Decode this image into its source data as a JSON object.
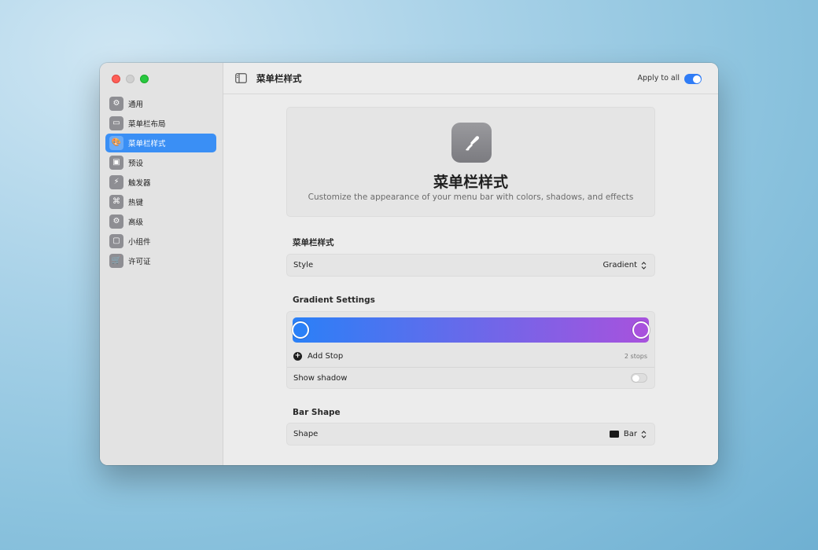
{
  "window": {
    "title": "菜单栏样式",
    "apply_to_all_label": "Apply to all",
    "apply_to_all_on": true
  },
  "sidebar": {
    "items": [
      {
        "label": "通用",
        "icon": "gear-icon",
        "glyph": "⚙",
        "active": false
      },
      {
        "label": "菜单栏布局",
        "icon": "menubar-layout-icon",
        "glyph": "▭",
        "active": false
      },
      {
        "label": "菜单栏样式",
        "icon": "palette-icon",
        "glyph": "🎨",
        "active": true
      },
      {
        "label": "预设",
        "icon": "preset-icon",
        "glyph": "▣",
        "active": false
      },
      {
        "label": "触发器",
        "icon": "bolt-icon",
        "glyph": "⚡",
        "active": false
      },
      {
        "label": "热键",
        "icon": "command-key-icon",
        "glyph": "⌘",
        "active": false
      },
      {
        "label": "高级",
        "icon": "gears-icon",
        "glyph": "⚙",
        "active": false
      },
      {
        "label": "小组件",
        "icon": "cube-icon",
        "glyph": "▢",
        "active": false
      },
      {
        "label": "许可证",
        "icon": "cart-icon",
        "glyph": "🛒",
        "active": false
      }
    ]
  },
  "hero": {
    "icon": "paintbrush-icon",
    "title": "菜单栏样式",
    "subtitle": "Customize the appearance of your menu bar with colors, shadows, and effects"
  },
  "style_section": {
    "title": "菜单栏样式",
    "row_label": "Style",
    "value": "Gradient"
  },
  "gradient_section": {
    "title": "Gradient Settings",
    "colors": {
      "start": "#2a80f7",
      "end": "#a852dd"
    },
    "add_stop_label": "Add Stop",
    "stops_count": "2 stops",
    "show_shadow_label": "Show shadow",
    "show_shadow_on": false
  },
  "shape_section": {
    "title": "Bar Shape",
    "row_label": "Shape",
    "value": "Bar"
  }
}
